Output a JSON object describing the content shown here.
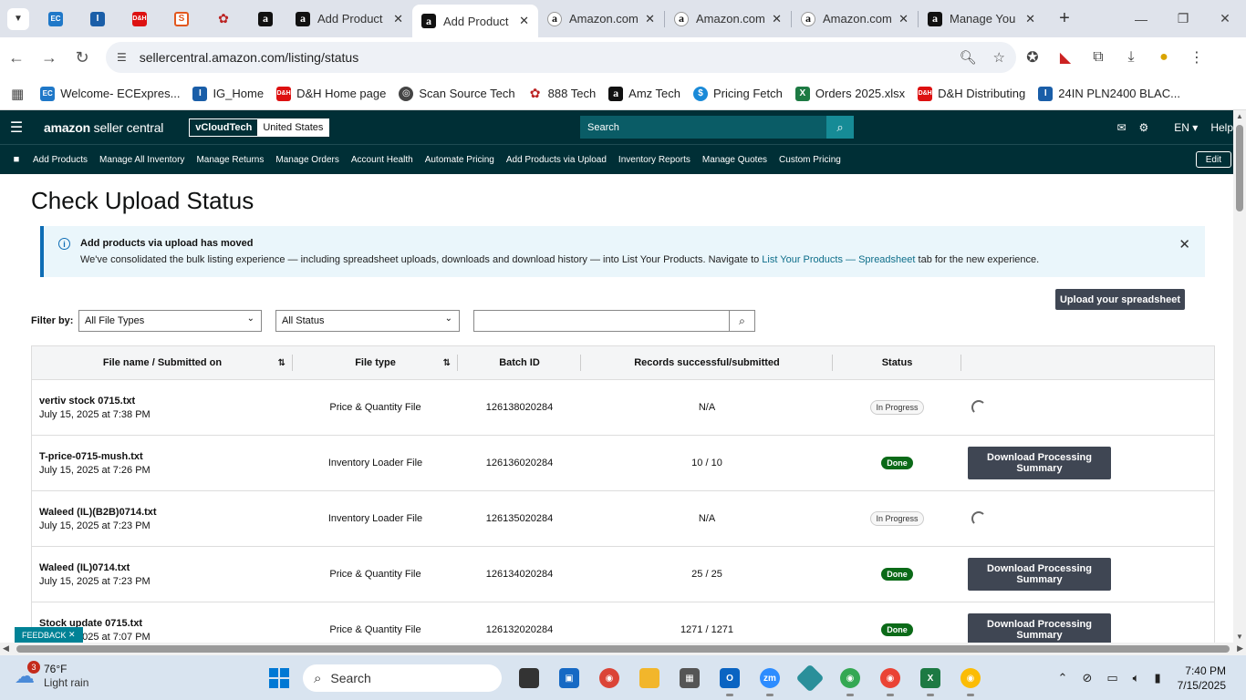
{
  "browser": {
    "tabs": [
      {
        "label": "Add Product",
        "icon": "amazon",
        "active": false
      },
      {
        "label": "Add Product",
        "icon": "amazon",
        "active": true
      },
      {
        "label": "Amazon.com",
        "icon": "amazon-smile",
        "active": false
      },
      {
        "label": "Amazon.com",
        "icon": "amazon-smile",
        "active": false
      },
      {
        "label": "Amazon.com",
        "icon": "amazon-smile",
        "active": false
      },
      {
        "label": "Manage You",
        "icon": "amazon",
        "active": false
      }
    ],
    "url": "sellercentral.amazon.com/listing/status",
    "bookmarks": [
      {
        "label": "Welcome- ECExpres...",
        "icon": "ec"
      },
      {
        "label": "IG_Home",
        "icon": "ig"
      },
      {
        "label": "D&H Home page",
        "icon": "dh"
      },
      {
        "label": "Scan Source Tech",
        "icon": "globe"
      },
      {
        "label": "888 Tech",
        "icon": "tech"
      },
      {
        "label": "Amz Tech",
        "icon": "amz"
      },
      {
        "label": "Pricing Fetch",
        "icon": "pf"
      },
      {
        "label": "Orders 2025.xlsx",
        "icon": "xl"
      },
      {
        "label": "D&H Distributing",
        "icon": "dh"
      },
      {
        "label": "24IN PLN2400 BLAC...",
        "icon": "ig"
      }
    ]
  },
  "header": {
    "logo_main": "amazon",
    "logo_sub": "seller central",
    "account": "vCloudTech",
    "marketplace": "United States",
    "search_placeholder": "Search",
    "language": "EN",
    "help": "Help"
  },
  "nav": {
    "items": [
      "Add Products",
      "Manage All Inventory",
      "Manage Returns",
      "Manage Orders",
      "Account Health",
      "Automate Pricing",
      "Add Products via Upload",
      "Inventory Reports",
      "Manage Quotes",
      "Custom Pricing"
    ],
    "edit": "Edit"
  },
  "page": {
    "title": "Check Upload Status",
    "alert": {
      "title": "Add products via upload has moved",
      "message_before": "We've consolidated the bulk listing experience — including spreadsheet uploads, downloads and download history — into List Your Products. Navigate to ",
      "link": "List Your Products — Spreadsheet",
      "message_after": " tab for the new experience."
    },
    "upload_button": "Upload your spreadsheet",
    "filter_label": "Filter by:",
    "file_type_filter": "All File Types",
    "status_filter": "All Status"
  },
  "table": {
    "headers": [
      "File name / Submitted on",
      "File type",
      "Batch ID",
      "Records successful/submitted",
      "Status"
    ],
    "rows": [
      {
        "name": "vertiv stock 0715.txt",
        "date": "July 15, 2025 at 7:38 PM",
        "type": "Price & Quantity File",
        "batch": "126138020284",
        "records": "N/A",
        "status": "In Progress",
        "action": ""
      },
      {
        "name": "T-price-0715-mush.txt",
        "date": "July 15, 2025 at 7:26 PM",
        "type": "Inventory Loader File",
        "batch": "126136020284",
        "records": "10 / 10",
        "status": "Done",
        "action": "Download Processing Summary"
      },
      {
        "name": "Waleed (IL)(B2B)0714.txt",
        "date": "July 15, 2025 at 7:23 PM",
        "type": "Inventory Loader File",
        "batch": "126135020284",
        "records": "N/A",
        "status": "In Progress",
        "action": ""
      },
      {
        "name": "Waleed (IL)0714.txt",
        "date": "July 15, 2025 at 7:23 PM",
        "type": "Price & Quantity File",
        "batch": "126134020284",
        "records": "25 / 25",
        "status": "Done",
        "action": "Download Processing Summary"
      },
      {
        "name": "Stock update 0715.txt",
        "date": "July 15, 2025 at 7:07 PM",
        "type": "Price & Quantity File",
        "batch": "126132020284",
        "records": "1271 / 1271",
        "status": "Done",
        "action": "Download Processing Summary"
      }
    ]
  },
  "feedback": "FEEDBACK",
  "taskbar": {
    "weather_badge": "3",
    "temp": "76°F",
    "condition": "Light rain",
    "search": "Search",
    "time": "7:40 PM",
    "date": "7/15/2025"
  },
  "colors": {
    "amazon_header": "#002f36",
    "button_dark": "#3f4653",
    "done_green": "#0b6a18",
    "alert_bg": "#eaf6fb"
  }
}
